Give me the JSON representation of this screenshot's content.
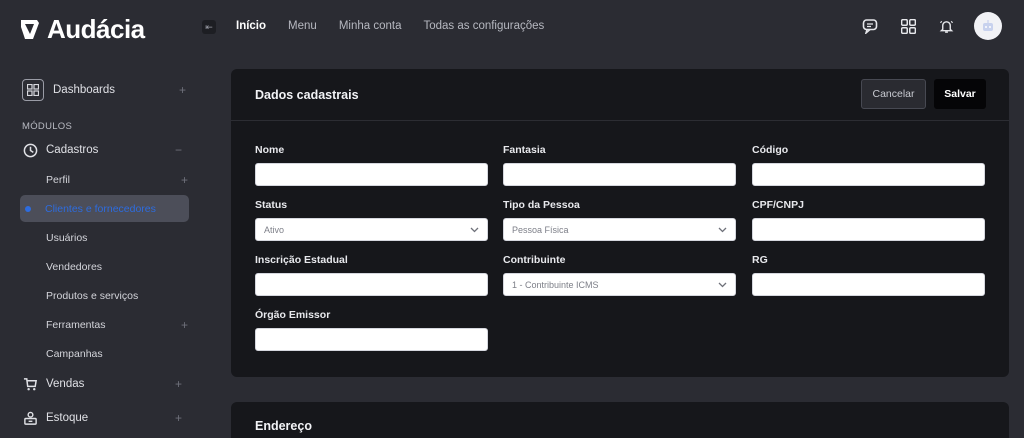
{
  "brand": {
    "name": "Audácia"
  },
  "sidebar": {
    "dashboards": "Dashboards",
    "section": "MÓDULOS",
    "cadastros": "Cadastros",
    "sub": [
      {
        "label": "Perfil"
      },
      {
        "label": "Clientes e fornecedores"
      },
      {
        "label": "Usuários"
      },
      {
        "label": "Vendedores"
      },
      {
        "label": "Produtos e serviços"
      },
      {
        "label": "Ferramentas"
      },
      {
        "label": "Campanhas"
      }
    ],
    "vendas": "Vendas",
    "estoque": "Estoque",
    "plus": "+",
    "minus": "−"
  },
  "topnav": {
    "items": [
      "Início",
      "Menu",
      "Minha conta",
      "Todas as configurações"
    ]
  },
  "card": {
    "title": "Dados cadastrais",
    "cancel": "Cancelar",
    "save": "Salvar",
    "fields": {
      "nome": {
        "label": "Nome",
        "value": ""
      },
      "fantasia": {
        "label": "Fantasia",
        "value": ""
      },
      "codigo": {
        "label": "Código",
        "value": ""
      },
      "status": {
        "label": "Status",
        "value": "Ativo"
      },
      "tipo": {
        "label": "Tipo da Pessoa",
        "value": "Pessoa Física"
      },
      "cpf": {
        "label": "CPF/CNPJ",
        "value": ""
      },
      "ie": {
        "label": "Inscrição Estadual",
        "value": ""
      },
      "contribuinte": {
        "label": "Contribuinte",
        "value": "1 - Contribuinte ICMS"
      },
      "rg": {
        "label": "RG",
        "value": ""
      },
      "orgao": {
        "label": "Órgão Emissor",
        "value": ""
      }
    }
  },
  "card2": {
    "title": "Endereço"
  },
  "colors": {
    "accent": "#2d6cdf",
    "bg": "#2b2c33",
    "card": "#16171b"
  }
}
